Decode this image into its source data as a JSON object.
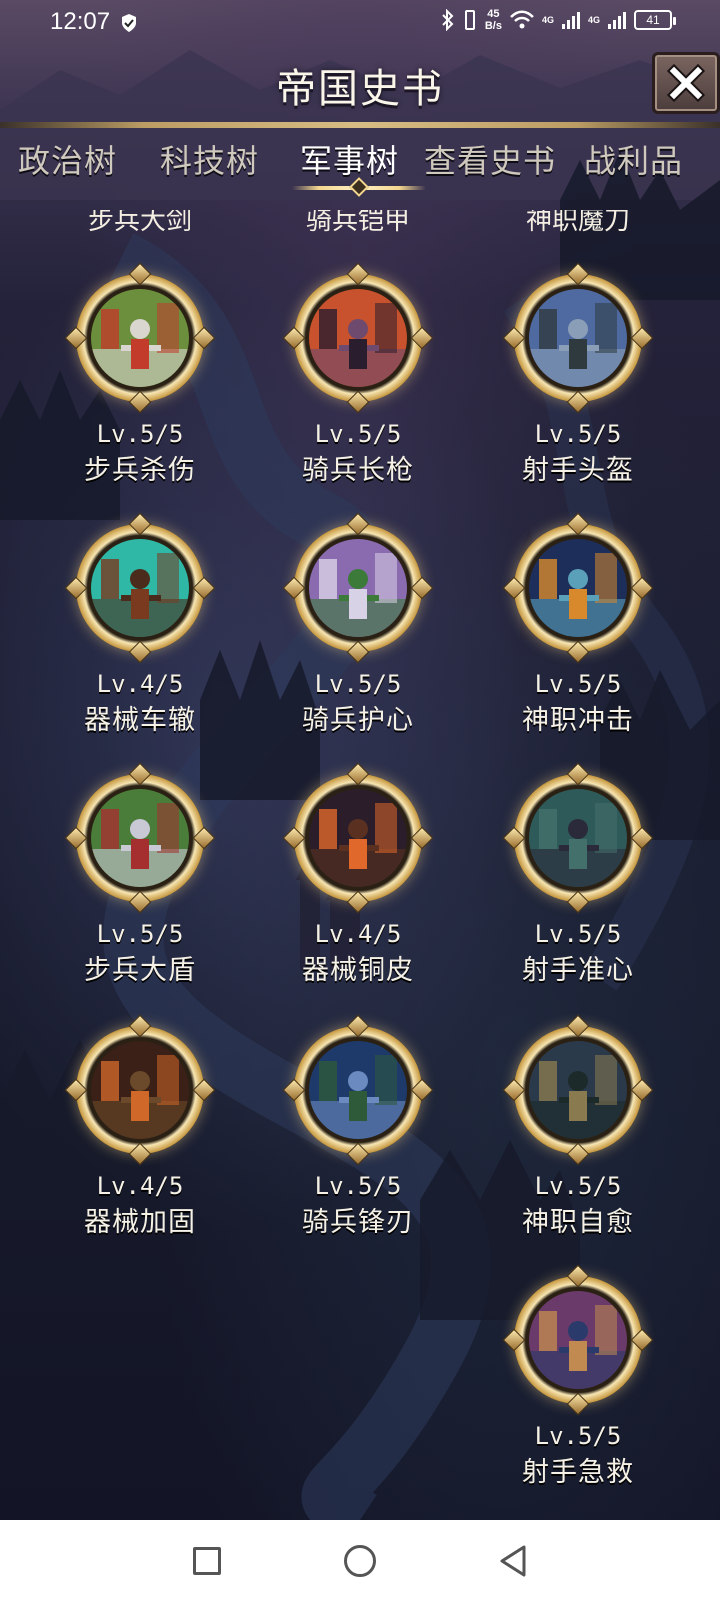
{
  "status_bar": {
    "time": "12:07",
    "net_speed_value": "45",
    "net_speed_unit": "B/s",
    "network_label_1": "4G",
    "network_label_2": "4G",
    "battery": "41"
  },
  "header": {
    "title": "帝国史书",
    "close_icon": "close-x-icon"
  },
  "tabs": [
    {
      "label": "政治树",
      "active": false
    },
    {
      "label": "科技树",
      "active": false
    },
    {
      "label": "军事树",
      "active": true
    },
    {
      "label": "查看史书",
      "active": false
    },
    {
      "label": "战利品",
      "active": false
    }
  ],
  "partial_row": [
    "步兵大剑",
    "骑兵铠甲",
    "神职魔刀"
  ],
  "skills": [
    {
      "level": "Lv.5/5",
      "name": "步兵杀伤",
      "icon": "infantry-knight-icon"
    },
    {
      "level": "Lv.5/5",
      "name": "骑兵长枪",
      "icon": "cavalry-rider-icon"
    },
    {
      "level": "Lv.5/5",
      "name": "射手头盔",
      "icon": "armored-warrior-icon"
    },
    {
      "level": "Lv.4/5",
      "name": "器械车辙",
      "icon": "siege-ruins-icon"
    },
    {
      "level": "Lv.5/5",
      "name": "骑兵护心",
      "icon": "charging-horse-icon"
    },
    {
      "level": "Lv.5/5",
      "name": "神职冲击",
      "icon": "cathedral-interior-icon"
    },
    {
      "level": "Lv.5/5",
      "name": "步兵大盾",
      "icon": "shield-soldier-icon"
    },
    {
      "level": "Lv.4/5",
      "name": "器械铜皮",
      "icon": "forge-fire-icon"
    },
    {
      "level": "Lv.5/5",
      "name": "射手准心",
      "icon": "forest-cottage-icon"
    },
    {
      "level": "Lv.4/5",
      "name": "器械加固",
      "icon": "workshop-wheel-icon"
    },
    {
      "level": "Lv.5/5",
      "name": "骑兵锋刃",
      "icon": "cavalry-squad-icon"
    },
    {
      "level": "Lv.5/5",
      "name": "神职自愈",
      "icon": "statue-temple-icon"
    },
    {
      "level": "Lv.5/5",
      "name": "射手急救",
      "icon": "chapel-icon"
    }
  ],
  "navbar": {
    "recent_icon": "square-icon",
    "home_icon": "circle-icon",
    "back_icon": "triangle-back-icon"
  },
  "colors": {
    "accent_gold": "#f3d68f",
    "background": "#1c1d31"
  }
}
